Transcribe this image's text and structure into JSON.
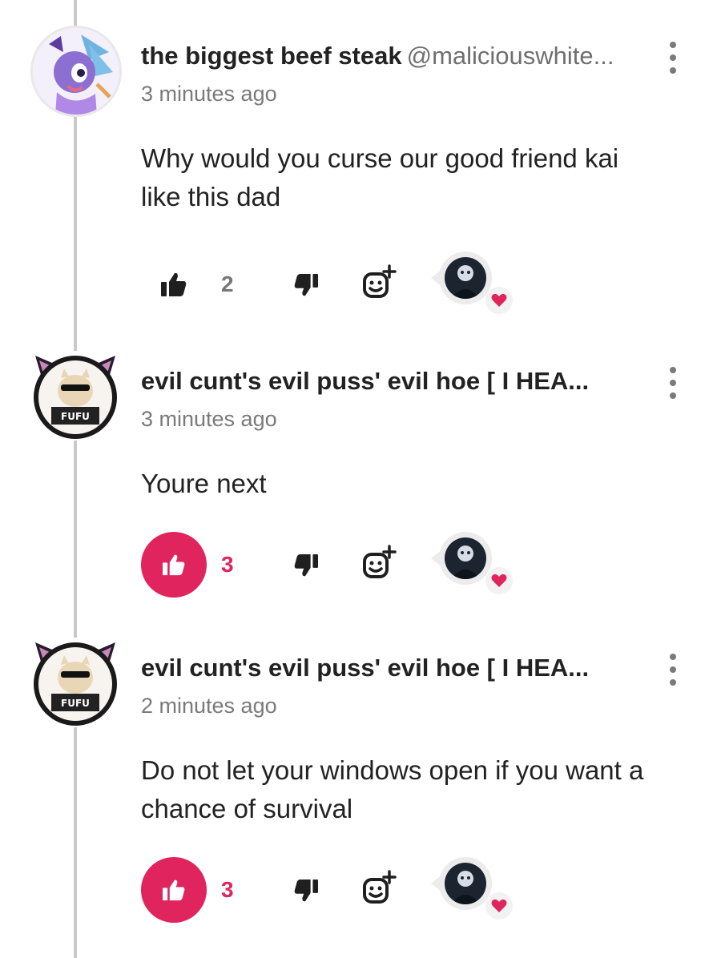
{
  "comments": [
    {
      "author": "the biggest beef steak",
      "handle": "@maliciouswhite...",
      "time": "3 minutes ago",
      "text_lines": [
        "Why would you curse our good friend kai",
        "like this dad"
      ],
      "likes": "2",
      "liked": false,
      "avatar_icon": "anime-character-avatar",
      "reaction_icon": "heart-icon"
    },
    {
      "author": "evil cunt's evil puss' evil hoe [ I HEA...",
      "handle": "",
      "time": "3 minutes ago",
      "text_lines": [
        "Youre next"
      ],
      "likes": "3",
      "liked": true,
      "avatar_icon": "cat-with-sunglasses-avatar",
      "reaction_icon": "heart-icon"
    },
    {
      "author": "evil cunt's evil puss' evil hoe [ I HEA...",
      "handle": "",
      "time": "2 minutes ago",
      "text_lines": [
        "Do not let your windows open if you want a",
        "chance of survival"
      ],
      "likes": "3",
      "liked": true,
      "avatar_icon": "cat-with-sunglasses-avatar",
      "reaction_icon": "heart-icon"
    }
  ],
  "colors": {
    "accent": "#e0245e",
    "thread_line": "#c9c9c9",
    "muted_text": "#7a7a7a"
  }
}
